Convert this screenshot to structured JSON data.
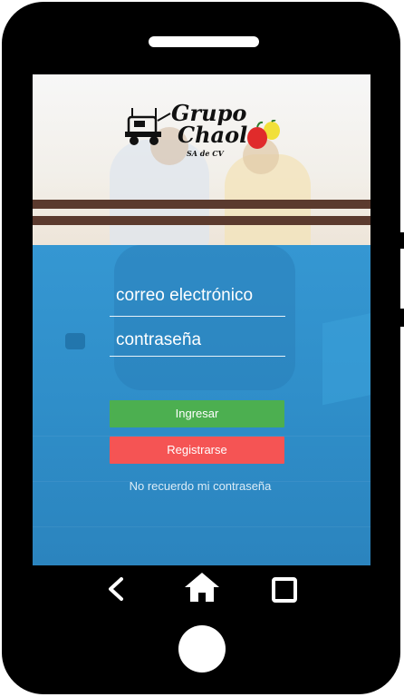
{
  "app": {
    "logo": {
      "line1": "Grupo",
      "line2": "Chaol",
      "line3": "SA de CV"
    }
  },
  "form": {
    "email_placeholder": "correo electrónico",
    "password_placeholder": "contraseña",
    "login_label": "Ingresar",
    "register_label": "Registrarse",
    "forgot_label": "No recuerdo mi contraseña"
  },
  "colors": {
    "login": "#4caf50",
    "register": "#f55454",
    "screen_blue": "#2f8fc8",
    "stripe": "#5b3a2e"
  },
  "device_nav": {
    "back_icon": "chevron-left-icon",
    "home_icon": "home-icon",
    "recents_icon": "square-icon"
  }
}
